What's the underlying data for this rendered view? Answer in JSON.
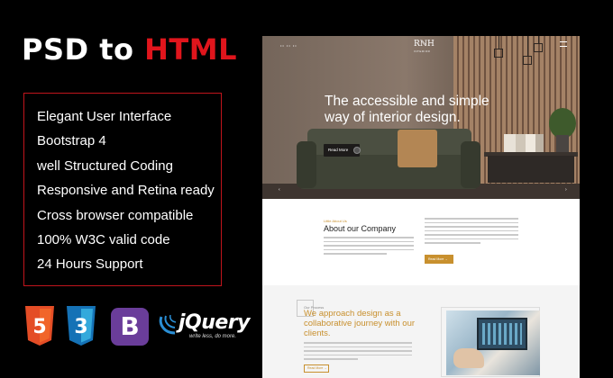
{
  "headline": {
    "part1": "PSD to ",
    "part2": "HTML"
  },
  "features": [
    "Elegant User Interface",
    "Bootstrap 4",
    "well Structured Coding",
    "Responsive and Retina ready",
    "Cross browser compatible",
    "100% W3C valid code",
    "24 Hours Support"
  ],
  "tech_badges": {
    "html5": {
      "label": "5",
      "color": "#e44d26"
    },
    "css3": {
      "label": "3",
      "color": "#1572b6"
    },
    "bootstrap": {
      "label": "B",
      "color": "#6a3d9a"
    },
    "jquery": {
      "word": "jQuery",
      "tagline": "write less, do more."
    }
  },
  "mockup": {
    "brand": "RℕH",
    "brand_sub": "INTERIOR",
    "nav": "••  ••  ••",
    "hero": {
      "title": "The accessible and simple way of interior design.",
      "button": "Read More",
      "arrow_left": "‹",
      "arrow_right": "›"
    },
    "about": {
      "kicker": "Little About Us",
      "title": "About our Company",
      "button": "Read More →"
    },
    "approach": {
      "kicker": "Our Process",
      "title": "We approach design as a collaborative journey with our clients.",
      "button": "Read More →"
    }
  },
  "colors": {
    "accent_red": "#e0151c",
    "mock_gold": "#c8902e"
  }
}
